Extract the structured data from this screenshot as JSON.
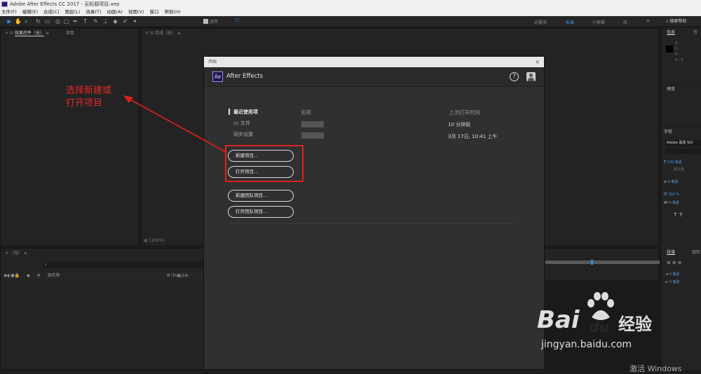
{
  "app": {
    "title": "Adobe After Effects CC 2017 - 无标题项目.aep"
  },
  "menu": [
    "文件(F)",
    "编辑(E)",
    "合成(C)",
    "图层(L)",
    "效果(T)",
    "动画(A)",
    "视图(V)",
    "窗口",
    "帮助(H)"
  ],
  "toolbar": {
    "snap_label": "对齐",
    "workspaces": [
      "必要项",
      "标准",
      "小屏幕",
      "库"
    ],
    "active_workspace": "标准",
    "search_help": "搜索帮助"
  },
  "panels": {
    "effect_controls_tab": "效果控件（无）",
    "project_tab": "项目",
    "composition_tab": "合成（无）",
    "zoom": "(100%)",
    "timeline_tab": "（无）",
    "layer_name_header": "源名称"
  },
  "right_panel": {
    "info_tab": "信息",
    "info_tab2": "音",
    "info_values": [
      "R :",
      "G :",
      "B :",
      "A : 0"
    ],
    "preview_tab": "预览",
    "character_tab": "字符",
    "character_font": "Adobe 黑体 Std",
    "font_size": "120 像素",
    "font_size_sub": "默认值",
    "leading": "0 像素",
    "scale": "100 %",
    "baseline": "0 像素",
    "paragraph_tab": "段落",
    "paragraph_tab2": "跟踪",
    "para_values": [
      "0 像素",
      "0 像素"
    ]
  },
  "dialog": {
    "window_title": "开始",
    "app_name": "After Effects",
    "help_icon": "?",
    "recent_label": "最近使用项",
    "cc_files": "cc 文件",
    "sync_settings": "同步设置",
    "col_name": "名称",
    "col_last_opened": "上次打开时间",
    "times": [
      "10 分钟前",
      "3月 17日, 10:41 上午"
    ],
    "buttons": [
      "新建项目...",
      "打开项目...",
      "新建团队项目...",
      "打开团队项目..."
    ]
  },
  "annotation": {
    "line1": "选择新建或",
    "line2": "打开项目"
  },
  "watermark": {
    "brand_left": "Bai",
    "brand_right": "du",
    "brand_cn": "经验",
    "url": "jingyan.baidu.com",
    "activate": "激活 Windows"
  },
  "colors": {
    "annotation_red": "#e02020",
    "ae_purple": "#9a8cff",
    "active_blue": "#2d8ceb"
  }
}
